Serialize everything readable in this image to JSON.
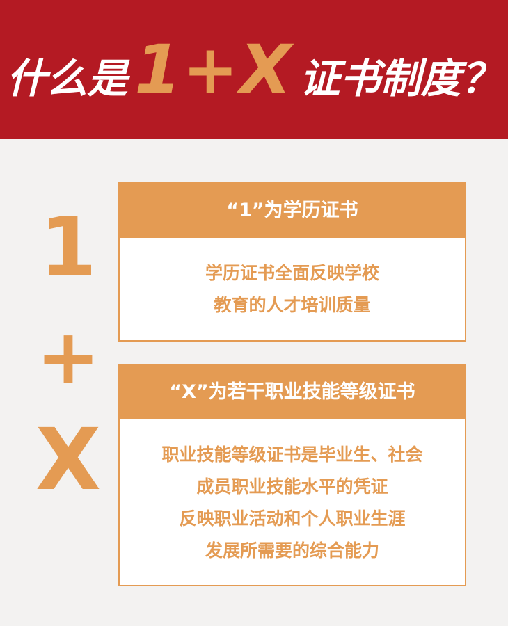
{
  "header": {
    "title_prefix": "什么是",
    "title_accent": "1+X",
    "title_suffix": "证书制度？"
  },
  "left_labels": {
    "one": "1",
    "plus": "+",
    "x": "X"
  },
  "cards": {
    "one": {
      "heading": "“1”为学历证书",
      "lines": [
        "学历证书全面反映学校",
        "教育的人才培训质量"
      ]
    },
    "x": {
      "heading": "“X”为若干职业技能等级证书",
      "lines": [
        "职业技能等级证书是毕业生、社会",
        "成员职业技能水平的凭证",
        "反映职业活动和个人职业生涯",
        "发展所需要的综合能力"
      ]
    }
  },
  "colors": {
    "header_bg": "#b41a23",
    "accent": "#e49b53",
    "page_bg": "#f3f2f1"
  }
}
